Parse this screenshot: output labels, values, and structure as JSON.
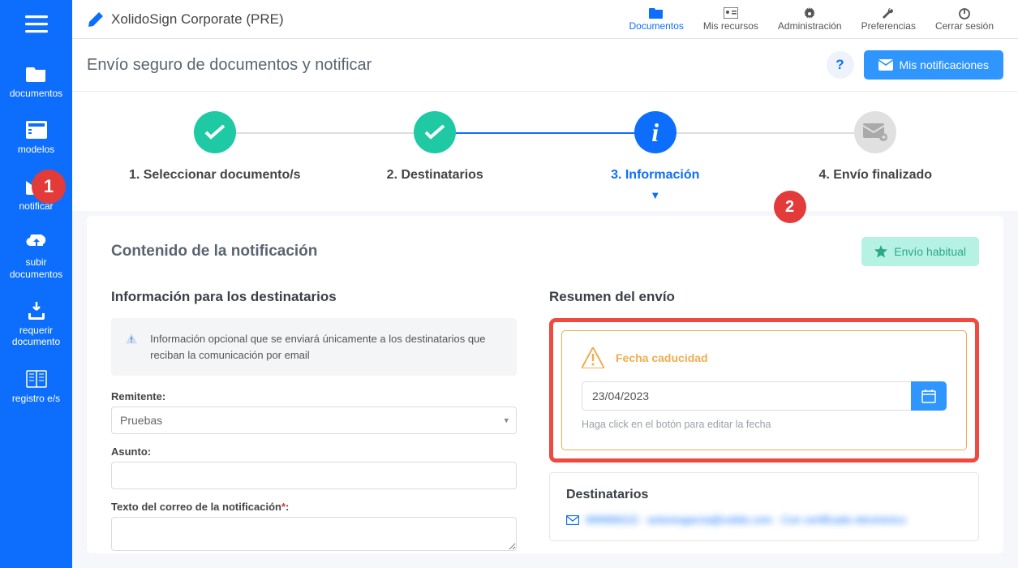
{
  "brand": {
    "title": "XolidoSign Corporate (PRE)"
  },
  "topnav": {
    "documentos": "Documentos",
    "recursos": "Mis recursos",
    "admin": "Administración",
    "prefs": "Preferencias",
    "logout": "Cerrar sesión"
  },
  "sidebar": {
    "documentos": "documentos",
    "modelos": "modelos",
    "notificar": "notificar",
    "subir": "subir documentos",
    "requerir": "requerir documento",
    "registro": "registro e/s",
    "badge1": "1"
  },
  "subheader": {
    "title": "Envío seguro de documentos y notificar",
    "help": "?",
    "btn": "Mis notificaciones"
  },
  "stepper": {
    "s1": "1. Seleccionar documento/s",
    "s2": "2. Destinatarios",
    "s3": "3. Información",
    "s4": "4. Envío finalizado",
    "badge2": "2"
  },
  "content": {
    "title": "Contenido de la notificación",
    "habitual": "Envío habitual",
    "left": {
      "title": "Información para los destinatarios",
      "banner": "Información opcional que se enviará únicamente a los destinatarios que reciban la comunicación por email",
      "remitente_label": "Remitente:",
      "remitente_value": "Pruebas",
      "asunto_label": "Asunto:",
      "asunto_value": "",
      "texto_label": "Texto del correo de la notificación",
      "texto_req": "*",
      "texto_value": ""
    },
    "right": {
      "title": "Resumen del envío",
      "expiry_title": "Fecha caducidad",
      "expiry_value": "23/04/2023",
      "expiry_hint": "Haga click en el botón para editar la fecha",
      "dest_title": "Destinatarios",
      "dest_row": "999999222 · antoniogarcia@xolido.com · Con certificado electrónico"
    }
  }
}
